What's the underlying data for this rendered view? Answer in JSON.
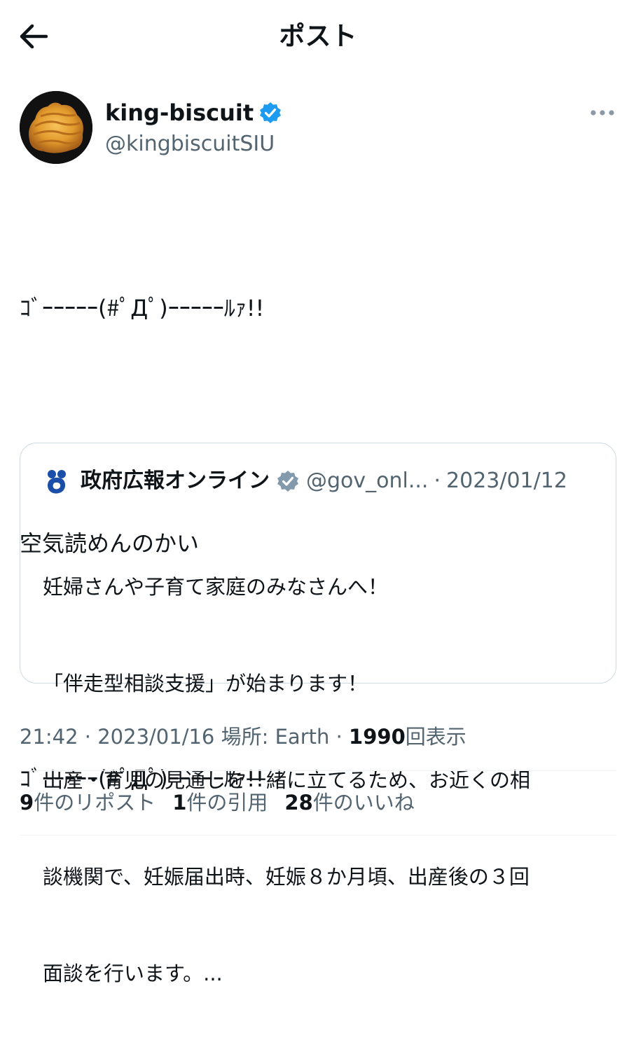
{
  "header": {
    "title": "ポスト",
    "back_icon": "arrow-left-icon"
  },
  "author": {
    "name": "king-biscuit",
    "handle": "@kingbiscuitSIU",
    "verified_color": "#1d9bf0",
    "more_icon": "more-horizontal-icon"
  },
  "tweet": {
    "line1": "ｺﾞｰｰｰｰｰ(#ﾟДﾟ)ｰｰｰｰｰﾙｧ!!",
    "line2": "空気読めんのかい",
    "line3": "ｺﾞｰｰｰｰｰ(#ﾟДﾟ)ｰｰｰｰｰﾙｧ!!"
  },
  "quote": {
    "name": "政府広報オンライン",
    "handle": "@gov_onl...",
    "sep": "·",
    "date": "2023/01/12",
    "verified_color": "#829aab",
    "text_lines": [
      "妊婦さんや子育て家庭のみなさんへ！",
      "「伴走型相談支援」が始まります！",
      "出産・育児の見通しを一緒に立てるため、お近くの相",
      "談機関で、妊娠届出時、妊娠８か月頃、出産後の３回",
      "面談を行います。..."
    ]
  },
  "meta": {
    "time": "21:42",
    "date": "2023/01/16",
    "sep": "·",
    "location": "場所: Earth",
    "views_count": "1990",
    "views_label": "回表示"
  },
  "stats": {
    "reposts_count": "9",
    "reposts_label": "件のリポスト",
    "quotes_count": "1",
    "quotes_label": "件の引用",
    "likes_count": "28",
    "likes_label": "件のいいね"
  },
  "colors": {
    "text": "#0f1419",
    "secondary": "#536471",
    "border": "#cfd9de"
  }
}
